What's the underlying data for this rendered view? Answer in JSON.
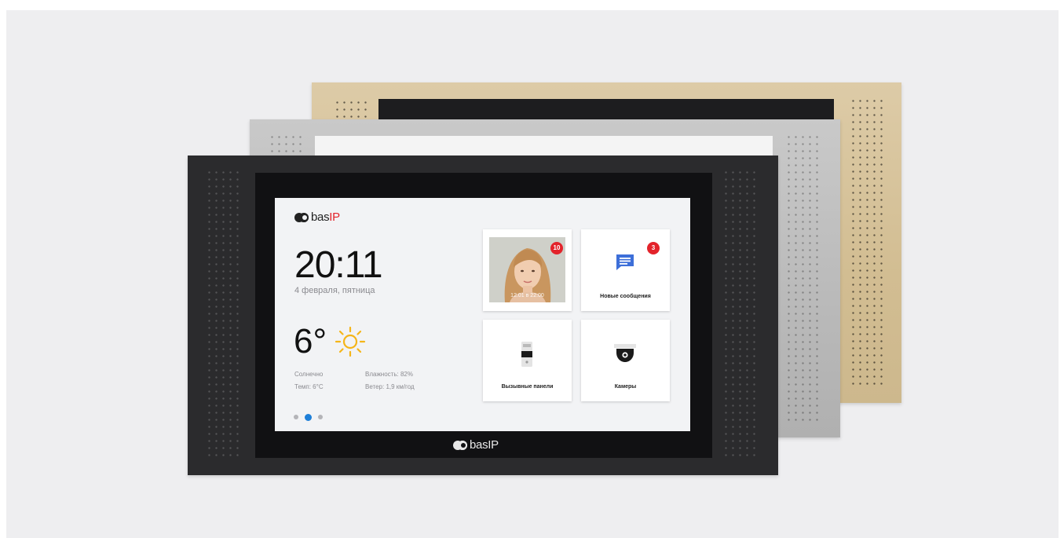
{
  "screen": {
    "brand": {
      "name_main": "bas",
      "name_accent": "IP"
    },
    "clock": {
      "time": "20:11",
      "date": "4 февраля, пятница"
    },
    "weather": {
      "temperature": "6°",
      "condition_icon": "sun-icon",
      "condition": "Солнечно",
      "feels_like": "Темп: 6°C",
      "humidity": "Влажность: 82%",
      "wind": "Ветер: 1,9 км/год"
    },
    "pagination": {
      "pages": 3,
      "current": 2
    },
    "tiles": {
      "calls": {
        "badge": "10",
        "timestamp": "12.01 в 22:00",
        "image": "visitor-photo"
      },
      "messages": {
        "badge": "3",
        "label": "Новые сообщения",
        "icon": "message-icon"
      },
      "panels": {
        "label": "Вызывные панели",
        "icon": "intercom-panel-icon"
      },
      "cameras": {
        "label": "Камеры",
        "icon": "dome-camera-icon"
      }
    }
  },
  "device_brand": {
    "name_main": "bas",
    "name_accent": "IP"
  },
  "colors": {
    "background": "#eeeef0",
    "panel_black": "#2b2b2d",
    "panel_silver": "#b9b9b9",
    "panel_gold": "#d2bd92",
    "accent_red": "#e3232b",
    "message_blue": "#3d6fd9",
    "sun_yellow": "#f5b519",
    "active_dot": "#1e7fd8"
  }
}
